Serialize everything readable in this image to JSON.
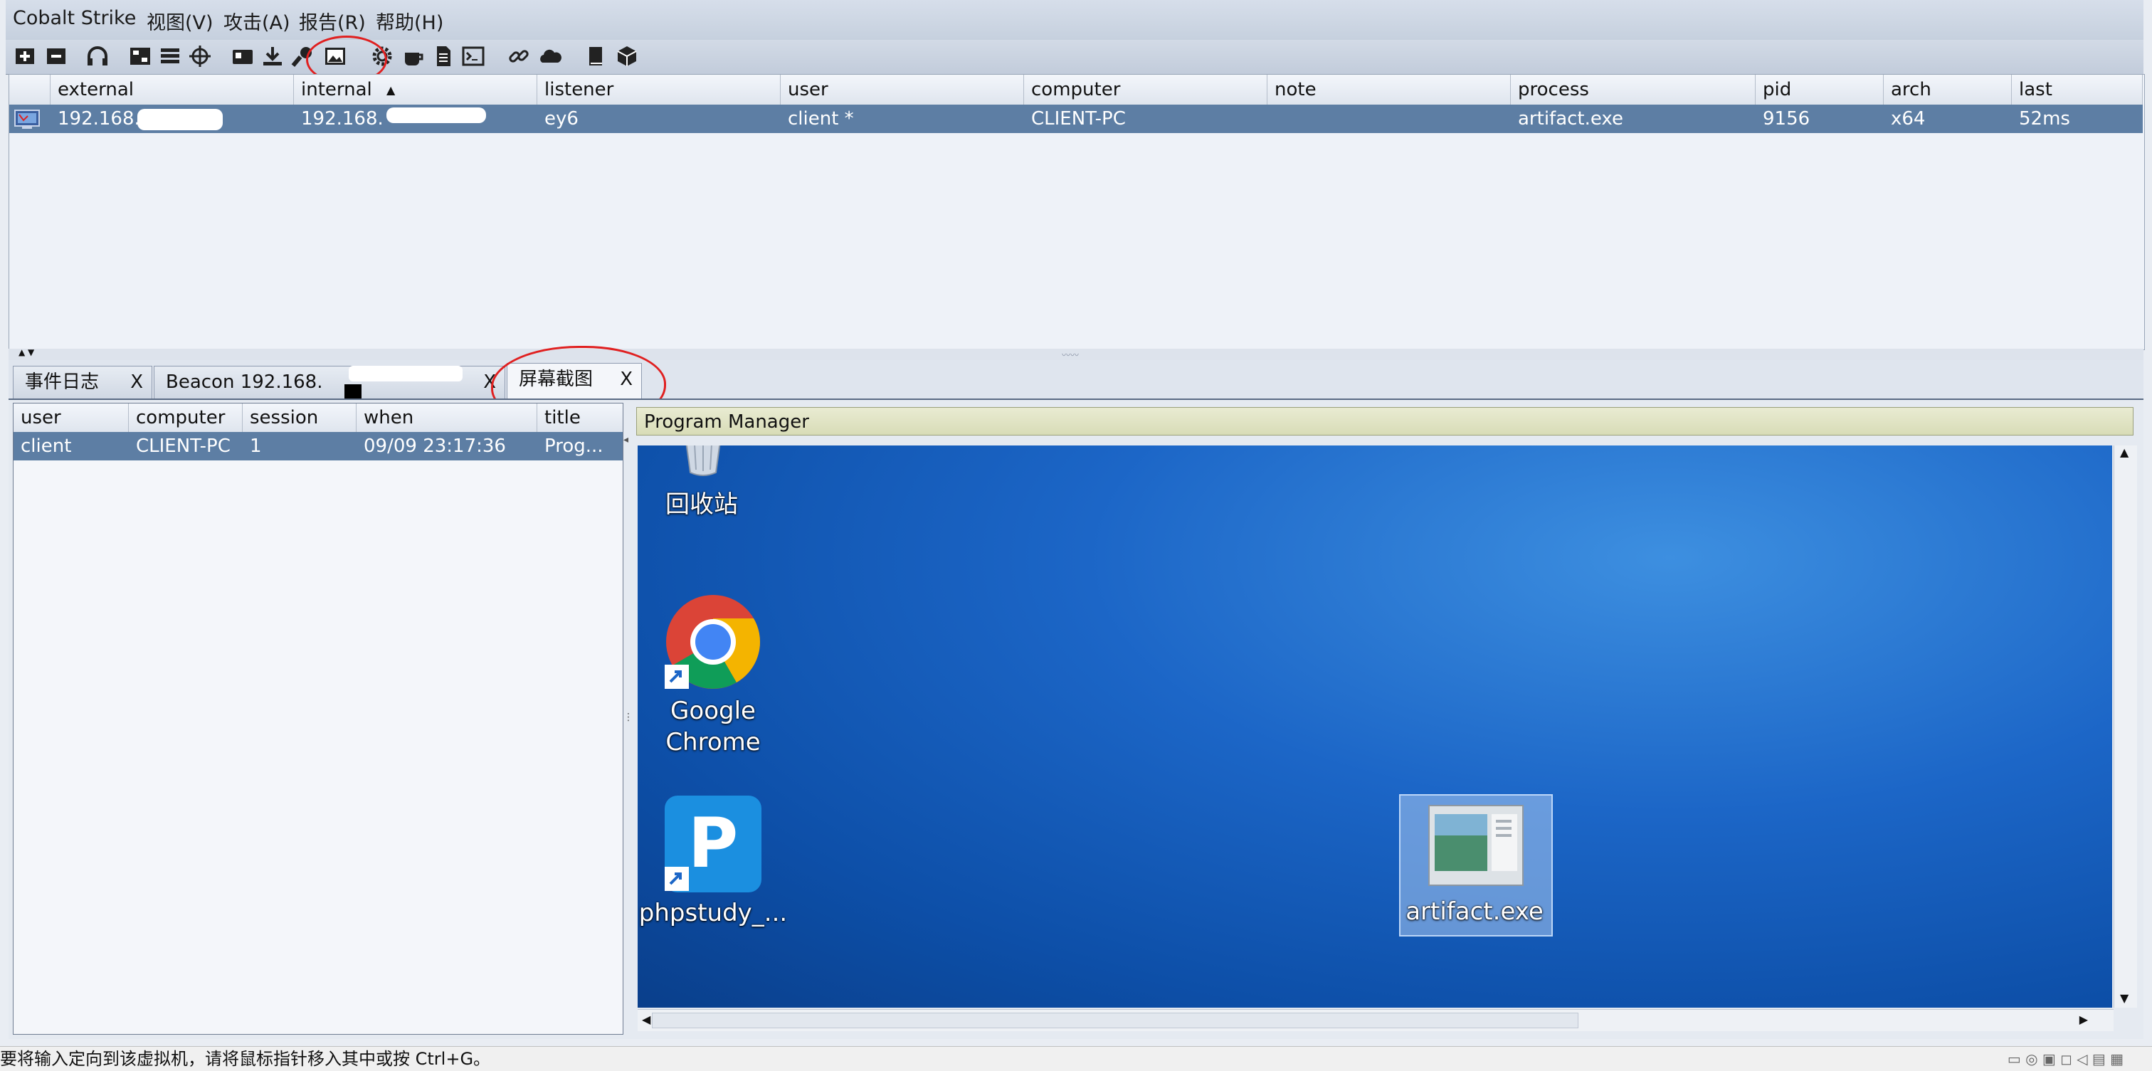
{
  "menu": {
    "app": "Cobalt Strike",
    "view": "视图(V)",
    "attack": "攻击(A)",
    "report": "报告(R)",
    "help": "帮助(H)"
  },
  "toolbar": {
    "icons": [
      "new-connection-icon",
      "disconnect-icon",
      "headphones-icon",
      "pivot-graph-icon",
      "session-table-icon",
      "targets-icon",
      "credentials-icon",
      "downloads-icon",
      "keystrokes-icon",
      "screenshots-icon",
      "settings-icon",
      "coffee-icon",
      "document-icon",
      "console-icon",
      "link-icon",
      "cloud-icon",
      "book-icon",
      "cube-icon"
    ]
  },
  "beacon_table": {
    "columns": [
      "external",
      "internal",
      "listener",
      "user",
      "computer",
      "note",
      "process",
      "pid",
      "arch",
      "last"
    ],
    "sort_indicator": "▲",
    "row": {
      "external": "192.168.",
      "internal": "192.168.",
      "listener": "ey6",
      "user": "client *",
      "computer": "CLIENT-PC",
      "note": "",
      "process": "artifact.exe",
      "pid": "9156",
      "arch": "x64",
      "last": "52ms"
    }
  },
  "tabs": [
    {
      "label": "事件日志",
      "close": "X"
    },
    {
      "label": "Beacon 192.168.",
      "close": "X"
    },
    {
      "label": "屏幕截图",
      "close": "X"
    }
  ],
  "screenshot_table": {
    "columns": [
      "user",
      "computer",
      "session",
      "when",
      "title"
    ],
    "row": {
      "user": "client",
      "computer": "CLIENT-PC",
      "session": "1",
      "when": "09/09 23:17:36",
      "title": "Prog..."
    }
  },
  "viewer": {
    "title": "Program Manager",
    "desktop_icons": [
      {
        "label": "回收站",
        "icon": "recycle-bin-icon"
      },
      {
        "label": "Google Chrome",
        "line1": "Google",
        "line2": "Chrome",
        "icon": "chrome-icon"
      },
      {
        "label": "phpstudy_...",
        "icon": "phpstudy-icon"
      },
      {
        "label": "artifact.exe",
        "icon": "executable-icon"
      }
    ]
  },
  "status": {
    "hint": "要将输入定向到该虚拟机，请将鼠标指针移入其中或按 Ctrl+G。"
  },
  "colors": {
    "selection": "#5d7ea4",
    "desktop_blue": "#1c66c7",
    "annotation_red": "#e02020"
  }
}
